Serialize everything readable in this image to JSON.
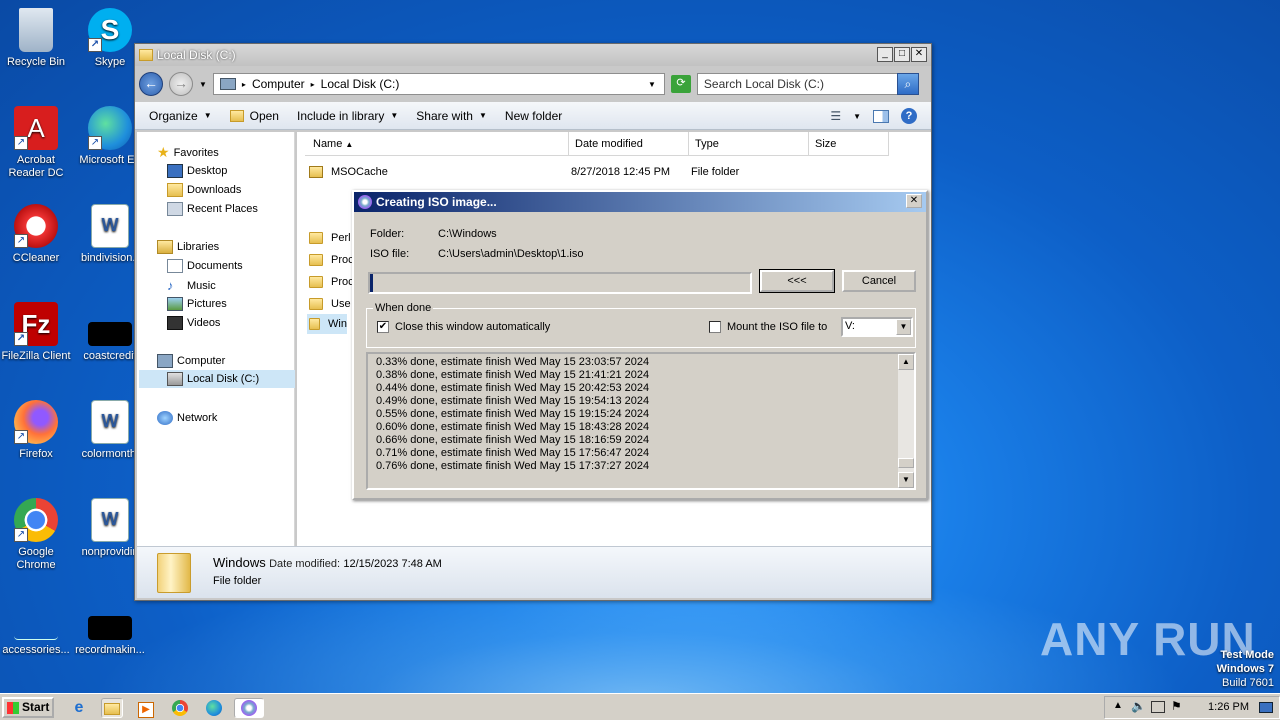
{
  "desktop": {
    "icons": [
      {
        "label": "Recycle Bin"
      },
      {
        "label": "Skype"
      },
      {
        "label": "Acrobat Reader DC"
      },
      {
        "label": "Microsoft Ed"
      },
      {
        "label": "CCleaner"
      },
      {
        "label": "bindivision.r"
      },
      {
        "label": "FileZilla Client"
      },
      {
        "label": "coastcredit"
      },
      {
        "label": "Firefox"
      },
      {
        "label": "colormonthl"
      },
      {
        "label": "Google Chrome"
      },
      {
        "label": "nonprovidin"
      },
      {
        "label": "accessories..."
      },
      {
        "label": "recordmakin..."
      }
    ],
    "watermark": "ANY RUN",
    "test_mode": [
      "Test Mode",
      "Windows 7",
      "Build 7601"
    ]
  },
  "explorer": {
    "title": "Local Disk (C:)",
    "address": [
      "Computer",
      "Local Disk (C:)"
    ],
    "search_placeholder": "Search Local Disk (C:)",
    "toolbar": {
      "organize": "Organize",
      "open": "Open",
      "include_in_library": "Include in library",
      "share_with": "Share with",
      "new_folder": "New folder"
    },
    "nav": {
      "favorites": "Favorites",
      "desktop": "Desktop",
      "downloads": "Downloads",
      "recent_places": "Recent Places",
      "libraries": "Libraries",
      "documents": "Documents",
      "music": "Music",
      "pictures": "Pictures",
      "videos": "Videos",
      "computer": "Computer",
      "local_disk": "Local Disk (C:)",
      "network": "Network"
    },
    "columns": [
      "Name",
      "Date modified",
      "Type",
      "Size"
    ],
    "files": [
      {
        "name": "MSOCache",
        "date": "8/27/2018 12:45 PM",
        "type": "File folder"
      },
      {
        "name": "Perl",
        "date": "",
        "type": ""
      },
      {
        "name": "Proc",
        "date": "",
        "type": ""
      },
      {
        "name": "Proc",
        "date": "",
        "type": ""
      },
      {
        "name": "Use",
        "date": "",
        "type": ""
      },
      {
        "name": "Win",
        "date": "",
        "type": ""
      }
    ],
    "status": {
      "name": "Windows",
      "date_label": "Date modified:",
      "date": "12/15/2023 7:48 AM",
      "type": "File folder"
    }
  },
  "dialog": {
    "title": "Creating ISO image...",
    "folder_label": "Folder:",
    "folder_value": "C:\\Windows",
    "iso_label": "ISO file:",
    "iso_value": "C:\\Users\\admin\\Desktop\\1.iso",
    "progress_fraction": 0.0076,
    "collapse_btn": "<<<",
    "cancel_btn": "Cancel",
    "when_done": "When done",
    "close_auto": "Close this window automatically",
    "close_auto_checked": true,
    "mount_label": "Mount the ISO file to",
    "mount_checked": false,
    "drive": "V:",
    "log": [
      "0.33% done, estimate finish Wed May 15 23:03:57 2024",
      "0.38% done, estimate finish Wed May 15 21:41:21 2024",
      "0.44% done, estimate finish Wed May 15 20:42:53 2024",
      "0.49% done, estimate finish Wed May 15 19:54:13 2024",
      "0.55% done, estimate finish Wed May 15 19:15:24 2024",
      "0.60% done, estimate finish Wed May 15 18:43:28 2024",
      "0.66% done, estimate finish Wed May 15 18:16:59 2024",
      "0.71% done, estimate finish Wed May 15 17:56:47 2024",
      "0.76% done, estimate finish Wed May 15 17:37:27 2024"
    ]
  },
  "taskbar": {
    "start": "Start",
    "clock": "1:26 PM"
  },
  "colors": {
    "desktop_blue": "#0d5fc7",
    "dialog_title": "#0a246a",
    "face": "#d4d0c8"
  }
}
